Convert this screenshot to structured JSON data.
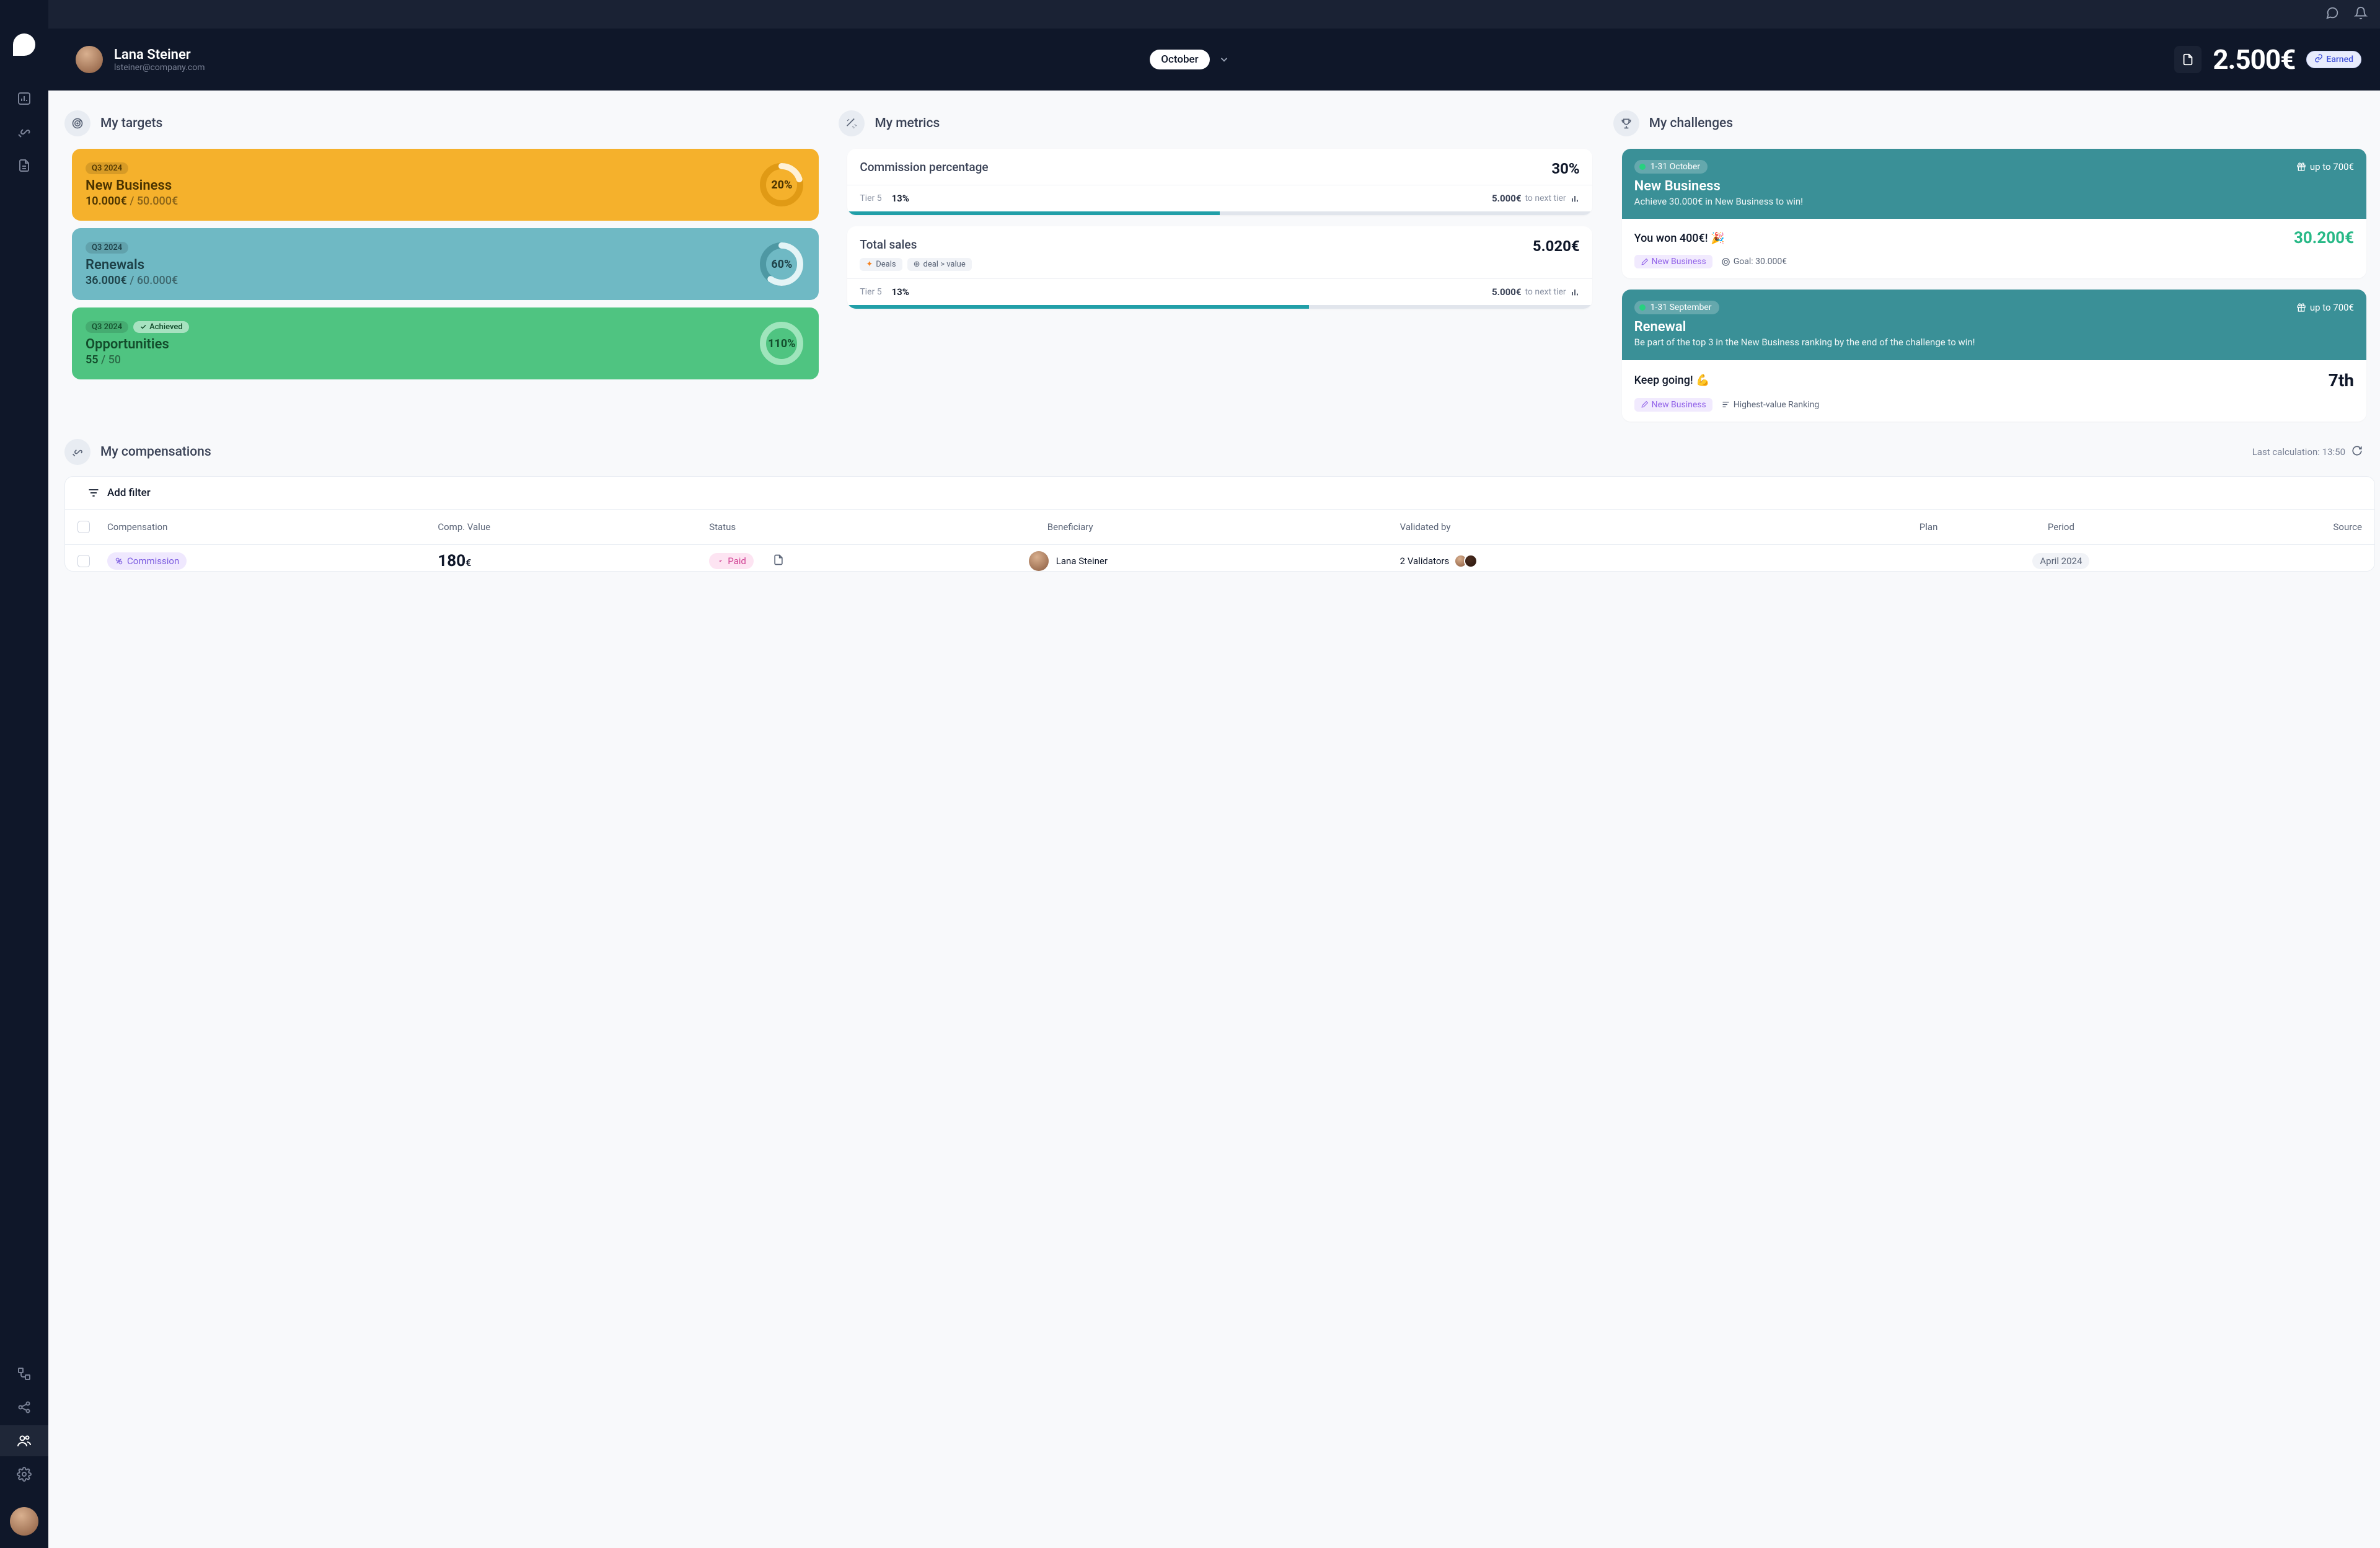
{
  "user": {
    "name": "Lana Steiner",
    "email": "lsteiner@company.com"
  },
  "header": {
    "month": "October",
    "amount": "2.500€",
    "earned_label": "Earned"
  },
  "sections": {
    "targets": "My targets",
    "metrics": "My metrics",
    "challenges": "My challenges",
    "compensations": "My compensations"
  },
  "targets": [
    {
      "period": "Q3 2024",
      "title": "New Business",
      "current": "10.000€",
      "total": "50.000€",
      "pct": "20%",
      "achieved": false
    },
    {
      "period": "Q3 2024",
      "title": "Renewals",
      "current": "36.000€",
      "total": "60.000€",
      "pct": "60%",
      "achieved": false
    },
    {
      "period": "Q3 2024",
      "title": "Opportunities",
      "current": "55",
      "total": "50",
      "pct": "110%",
      "achieved": true,
      "achieved_label": "Achieved"
    }
  ],
  "metrics": [
    {
      "name": "Commission percentage",
      "value": "30%",
      "tier": "Tier 5",
      "tier_pct": "13%",
      "next_amount": "5.000€",
      "next_label": "to next tier"
    },
    {
      "name": "Total sales",
      "value": "5.020€",
      "tags": [
        "Deals",
        "deal > value"
      ],
      "tier": "Tier 5",
      "tier_pct": "13%",
      "next_amount": "5.000€",
      "next_label": "to next tier"
    }
  ],
  "challenges": [
    {
      "dates": "1-31 October",
      "prize": "up to 700€",
      "title": "New Business",
      "desc": "Achieve 30.000€ in New Business to win!",
      "msg": "You won 400€! 🎉",
      "amount": "30.200€",
      "tag": "New Business",
      "goal_label": "Goal: 30.000€"
    },
    {
      "dates": "1-31 September",
      "prize": "up to 700€",
      "title": "Renewal",
      "desc": "Be part of the top 3 in the New Business ranking by the end of the challenge to win!",
      "msg": "Keep going! 💪",
      "rank": "7th",
      "tag": "New Business",
      "goal_label": "Highest-value Ranking"
    }
  ],
  "comp_header": {
    "add_filter": "Add filter",
    "last_calc": "Last calculation: 13:50",
    "cols": {
      "compensation": "Compensation",
      "value": "Comp. Value",
      "status": "Status",
      "beneficiary": "Beneficiary",
      "validated_by": "Validated by",
      "plan": "Plan",
      "period": "Period",
      "source": "Source"
    }
  },
  "comp_rows": [
    {
      "type": "Commission",
      "value": "180",
      "currency": "€",
      "status": "Paid",
      "beneficiary": "Lana Steiner",
      "validators": "2 Validators",
      "plan": "",
      "period": "April 2024",
      "source": ""
    }
  ]
}
